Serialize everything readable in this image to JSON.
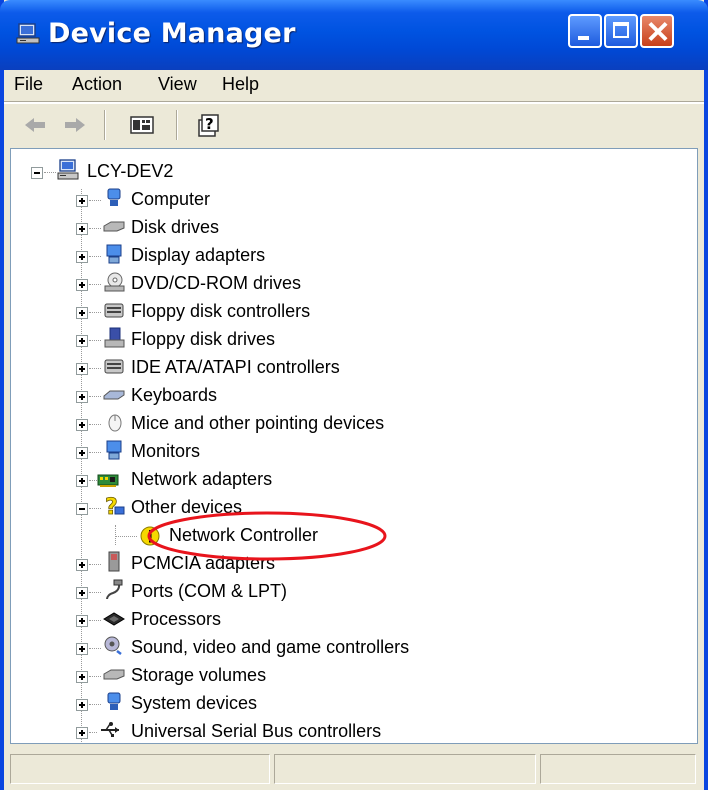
{
  "window": {
    "title": "Device Manager"
  },
  "menu": [
    "File",
    "Action",
    "View",
    "Help"
  ],
  "toolbar": [
    {
      "name": "back-icon"
    },
    {
      "name": "forward-icon"
    },
    {
      "name": "properties-icon"
    },
    {
      "name": "help-icon"
    }
  ],
  "tree": {
    "root": "LCY-DEV2",
    "categories": [
      {
        "label": "Computer",
        "icon": "computer-icon",
        "expanded": false
      },
      {
        "label": "Disk drives",
        "icon": "disk-drive-icon",
        "expanded": false
      },
      {
        "label": "Display adapters",
        "icon": "display-adapter-icon",
        "expanded": false
      },
      {
        "label": "DVD/CD-ROM drives",
        "icon": "dvd-drive-icon",
        "expanded": false
      },
      {
        "label": "Floppy disk controllers",
        "icon": "controller-icon",
        "expanded": false
      },
      {
        "label": "Floppy disk drives",
        "icon": "floppy-drive-icon",
        "expanded": false
      },
      {
        "label": "IDE ATA/ATAPI controllers",
        "icon": "controller-icon",
        "expanded": false
      },
      {
        "label": "Keyboards",
        "icon": "keyboard-icon",
        "expanded": false
      },
      {
        "label": "Mice and other pointing devices",
        "icon": "mouse-icon",
        "expanded": false
      },
      {
        "label": "Monitors",
        "icon": "monitor-icon",
        "expanded": false
      },
      {
        "label": "Network adapters",
        "icon": "network-adapter-icon",
        "expanded": false
      },
      {
        "label": "Other devices",
        "icon": "unknown-device-icon",
        "expanded": true,
        "children": [
          {
            "label": "Network Controller",
            "icon": "warning-icon",
            "highlighted": true
          }
        ]
      },
      {
        "label": "PCMCIA adapters",
        "icon": "pcmcia-icon",
        "expanded": false
      },
      {
        "label": "Ports (COM & LPT)",
        "icon": "port-icon",
        "expanded": false
      },
      {
        "label": "Processors",
        "icon": "processor-icon",
        "expanded": false
      },
      {
        "label": "Sound, video and game controllers",
        "icon": "sound-icon",
        "expanded": false
      },
      {
        "label": "Storage volumes",
        "icon": "storage-icon",
        "expanded": false
      },
      {
        "label": "System devices",
        "icon": "system-device-icon",
        "expanded": false
      },
      {
        "label": "Universal Serial Bus controllers",
        "icon": "usb-icon",
        "expanded": false
      }
    ]
  },
  "colors": {
    "titlebar": "#0053E1",
    "chrome": "#ECE9D8",
    "highlight_ellipse": "#E8141C",
    "warning": "#F5D800"
  }
}
